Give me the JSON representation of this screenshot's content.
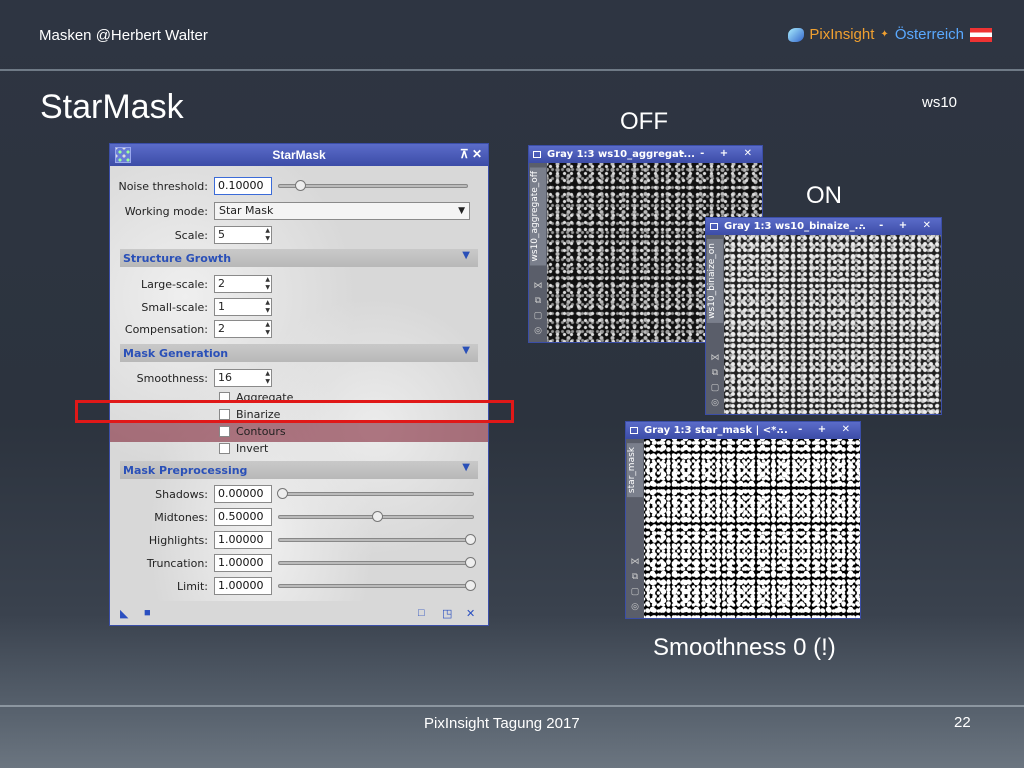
{
  "slide": {
    "header_left": "Masken  @Herbert Walter",
    "brand_primary": "PixInsight",
    "brand_sep": "✦",
    "brand_secondary": "Österreich",
    "title": "StarMask",
    "image_id": "ws10",
    "label_off": "OFF",
    "label_on": "ON",
    "label_smoothness": "Smoothness 0 (!)",
    "footer": "PixInsight Tagung 2017",
    "page_number": "22"
  },
  "dialog": {
    "title": "StarMask",
    "title_buttons": "⊼ ✕",
    "noise_threshold": {
      "label": "Noise threshold:",
      "value": "0.10000",
      "slider": 0.1
    },
    "working_mode": {
      "label": "Working mode:",
      "value": "Star Mask"
    },
    "scale": {
      "label": "Scale:",
      "value": "5"
    },
    "structure_growth": {
      "header": "Structure Growth",
      "large_scale": {
        "label": "Large-scale:",
        "value": "2"
      },
      "small_scale": {
        "label": "Small-scale:",
        "value": "1"
      },
      "compensation": {
        "label": "Compensation:",
        "value": "2"
      }
    },
    "mask_generation": {
      "header": "Mask Generation",
      "smoothness": {
        "label": "Smoothness:",
        "value": "16"
      },
      "aggregate": "Aggregate",
      "binarize": "Binarize",
      "contours": "Contours",
      "invert": "Invert"
    },
    "mask_preprocessing": {
      "header": "Mask Preprocessing",
      "shadows": {
        "label": "Shadows:",
        "value": "0.00000",
        "slider": 0.0
      },
      "midtones": {
        "label": "Midtones:",
        "value": "0.50000",
        "slider": 0.5
      },
      "highlights": {
        "label": "Highlights:",
        "value": "1.00000",
        "slider": 1.0
      },
      "truncation": {
        "label": "Truncation:",
        "value": "1.00000",
        "slider": 1.0
      },
      "limit": {
        "label": "Limit:",
        "value": "1.00000",
        "slider": 1.0
      }
    }
  },
  "windows": {
    "off": {
      "title": "Gray 1:3 ws10_aggregat...",
      "tab": "ws10_aggregate_off",
      "buttons": "- - + ✕"
    },
    "on": {
      "title": "Gray 1:3 ws10_binaize_...",
      "tab": "ws10_binaize_on",
      "buttons": "- - + ✕"
    },
    "mask": {
      "title": "Gray 1:3 star_mask | <*...",
      "tab": "star_mask",
      "buttons": "- - + ✕"
    }
  },
  "colors": {
    "accent_orange": "#f0a030",
    "accent_blue": "#5aa9ff",
    "highlight_red": "#e01818",
    "window_title": "#3c4ca7"
  }
}
